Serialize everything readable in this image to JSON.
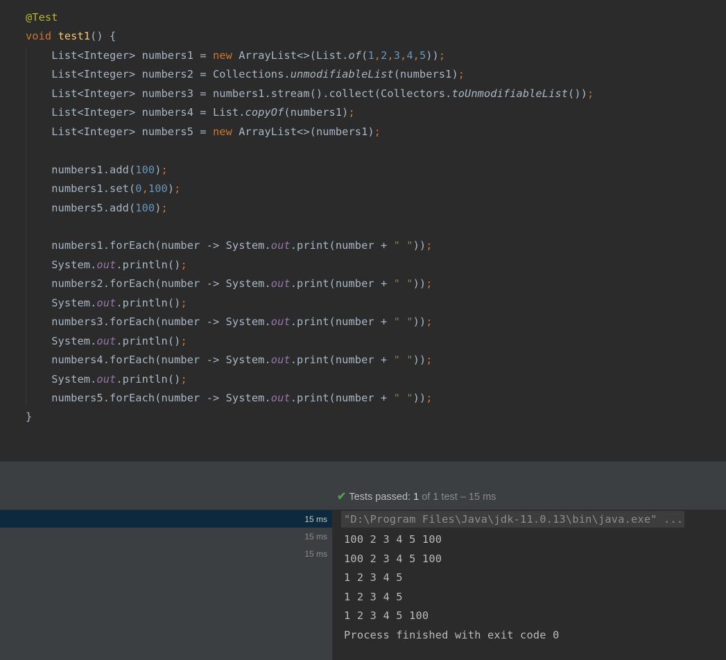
{
  "editor": {
    "lines": [
      {
        "segments": [
          {
            "t": "@Test",
            "c": "ann"
          }
        ]
      },
      {
        "segments": [
          {
            "t": "void ",
            "c": "kw"
          },
          {
            "t": "test1",
            "c": "fn"
          },
          {
            "t": "() {",
            "c": ""
          }
        ]
      },
      {
        "segments": [
          {
            "t": "    List<Integer> numbers1 = ",
            "c": ""
          },
          {
            "t": "new ",
            "c": "kw"
          },
          {
            "t": "ArrayList<>(List.",
            "c": ""
          },
          {
            "t": "of",
            "c": "it"
          },
          {
            "t": "(",
            "c": ""
          },
          {
            "t": "1",
            "c": "num"
          },
          {
            "t": ",",
            "c": "kw"
          },
          {
            "t": "2",
            "c": "num"
          },
          {
            "t": ",",
            "c": "kw"
          },
          {
            "t": "3",
            "c": "num"
          },
          {
            "t": ",",
            "c": "kw"
          },
          {
            "t": "4",
            "c": "num"
          },
          {
            "t": ",",
            "c": "kw"
          },
          {
            "t": "5",
            "c": "num"
          },
          {
            "t": "))",
            "c": ""
          },
          {
            "t": ";",
            "c": "kw"
          }
        ]
      },
      {
        "segments": [
          {
            "t": "    List<Integer> numbers2 = Collections.",
            "c": ""
          },
          {
            "t": "unmodifiableList",
            "c": "it"
          },
          {
            "t": "(numbers1)",
            "c": ""
          },
          {
            "t": ";",
            "c": "kw"
          }
        ]
      },
      {
        "segments": [
          {
            "t": "    List<Integer> numbers3 = numbers1.stream().collect(Collectors.",
            "c": ""
          },
          {
            "t": "toUnmodifiableList",
            "c": "it"
          },
          {
            "t": "())",
            "c": ""
          },
          {
            "t": ";",
            "c": "kw"
          }
        ]
      },
      {
        "segments": [
          {
            "t": "    List<Integer> numbers4 = List.",
            "c": ""
          },
          {
            "t": "copyOf",
            "c": "it"
          },
          {
            "t": "(numbers1)",
            "c": ""
          },
          {
            "t": ";",
            "c": "kw"
          }
        ]
      },
      {
        "segments": [
          {
            "t": "    List<Integer> numbers5 = ",
            "c": ""
          },
          {
            "t": "new ",
            "c": "kw"
          },
          {
            "t": "ArrayList<>(numbers1)",
            "c": ""
          },
          {
            "t": ";",
            "c": "kw"
          }
        ]
      },
      {
        "segments": []
      },
      {
        "segments": [
          {
            "t": "    numbers1.add(",
            "c": ""
          },
          {
            "t": "100",
            "c": "num"
          },
          {
            "t": ")",
            "c": ""
          },
          {
            "t": ";",
            "c": "kw"
          }
        ]
      },
      {
        "segments": [
          {
            "t": "    numbers1.set(",
            "c": ""
          },
          {
            "t": "0",
            "c": "num"
          },
          {
            "t": ",",
            "c": "kw"
          },
          {
            "t": "100",
            "c": "num"
          },
          {
            "t": ")",
            "c": ""
          },
          {
            "t": ";",
            "c": "kw"
          }
        ]
      },
      {
        "segments": [
          {
            "t": "    numbers5.add(",
            "c": ""
          },
          {
            "t": "100",
            "c": "num"
          },
          {
            "t": ")",
            "c": ""
          },
          {
            "t": ";",
            "c": "kw"
          }
        ]
      },
      {
        "segments": []
      },
      {
        "segments": [
          {
            "t": "    numbers1.forEach(number -> System.",
            "c": ""
          },
          {
            "t": "out",
            "c": "fld"
          },
          {
            "t": ".print(number + ",
            "c": ""
          },
          {
            "t": "\" \"",
            "c": "str"
          },
          {
            "t": "))",
            "c": ""
          },
          {
            "t": ";",
            "c": "kw"
          }
        ]
      },
      {
        "segments": [
          {
            "t": "    System.",
            "c": ""
          },
          {
            "t": "out",
            "c": "fld"
          },
          {
            "t": ".println()",
            "c": ""
          },
          {
            "t": ";",
            "c": "kw"
          }
        ]
      },
      {
        "segments": [
          {
            "t": "    numbers2.forEach(number -> System.",
            "c": ""
          },
          {
            "t": "out",
            "c": "fld"
          },
          {
            "t": ".print(number + ",
            "c": ""
          },
          {
            "t": "\" \"",
            "c": "str"
          },
          {
            "t": "))",
            "c": ""
          },
          {
            "t": ";",
            "c": "kw"
          }
        ]
      },
      {
        "segments": [
          {
            "t": "    System.",
            "c": ""
          },
          {
            "t": "out",
            "c": "fld"
          },
          {
            "t": ".println()",
            "c": ""
          },
          {
            "t": ";",
            "c": "kw"
          }
        ]
      },
      {
        "segments": [
          {
            "t": "    numbers3.forEach(number -> System.",
            "c": ""
          },
          {
            "t": "out",
            "c": "fld"
          },
          {
            "t": ".print(number + ",
            "c": ""
          },
          {
            "t": "\" \"",
            "c": "str"
          },
          {
            "t": "))",
            "c": ""
          },
          {
            "t": ";",
            "c": "kw"
          }
        ]
      },
      {
        "segments": [
          {
            "t": "    System.",
            "c": ""
          },
          {
            "t": "out",
            "c": "fld"
          },
          {
            "t": ".println()",
            "c": ""
          },
          {
            "t": ";",
            "c": "kw"
          }
        ]
      },
      {
        "segments": [
          {
            "t": "    numbers4.forEach(number -> System.",
            "c": ""
          },
          {
            "t": "out",
            "c": "fld"
          },
          {
            "t": ".print(number + ",
            "c": ""
          },
          {
            "t": "\" \"",
            "c": "str"
          },
          {
            "t": "))",
            "c": ""
          },
          {
            "t": ";",
            "c": "kw"
          }
        ]
      },
      {
        "segments": [
          {
            "t": "    System.",
            "c": ""
          },
          {
            "t": "out",
            "c": "fld"
          },
          {
            "t": ".println()",
            "c": ""
          },
          {
            "t": ";",
            "c": "kw"
          }
        ]
      },
      {
        "segments": [
          {
            "t": "    numbers5.forEach(number -> System.",
            "c": ""
          },
          {
            "t": "out",
            "c": "fld"
          },
          {
            "t": ".print(number + ",
            "c": ""
          },
          {
            "t": "\" \"",
            "c": "str"
          },
          {
            "t": "))",
            "c": ""
          },
          {
            "t": ";",
            "c": "kw"
          }
        ]
      },
      {
        "segments": [
          {
            "t": "}",
            "c": ""
          }
        ]
      }
    ]
  },
  "run_panel": {
    "status": {
      "prefix": "Tests passed: ",
      "passed": "1",
      "suffix": " of 1 test – 15 ms",
      "icon": "check-icon"
    },
    "test_tree": [
      {
        "duration": "15 ms",
        "selected": true
      },
      {
        "duration": "15 ms",
        "selected": false
      },
      {
        "duration": "15 ms",
        "selected": false
      }
    ],
    "console": {
      "command": "\"D:\\Program Files\\Java\\jdk-11.0.13\\bin\\java.exe\" ...",
      "output": [
        "100 2 3 4 5 100",
        "100 2 3 4 5 100",
        "1 2 3 4 5",
        "1 2 3 4 5",
        "1 2 3 4 5 100",
        "Process finished with exit code 0"
      ]
    }
  },
  "colors": {
    "editor_bg": "#2b2b2b",
    "panel_bg": "#3c3f41",
    "selection": "#0d293e",
    "keyword": "#cc7832",
    "annotation": "#bbb529",
    "method_decl": "#ffc66d",
    "number": "#6897bb",
    "string": "#6a8759",
    "field": "#9876aa",
    "pass_green": "#4fa052"
  }
}
